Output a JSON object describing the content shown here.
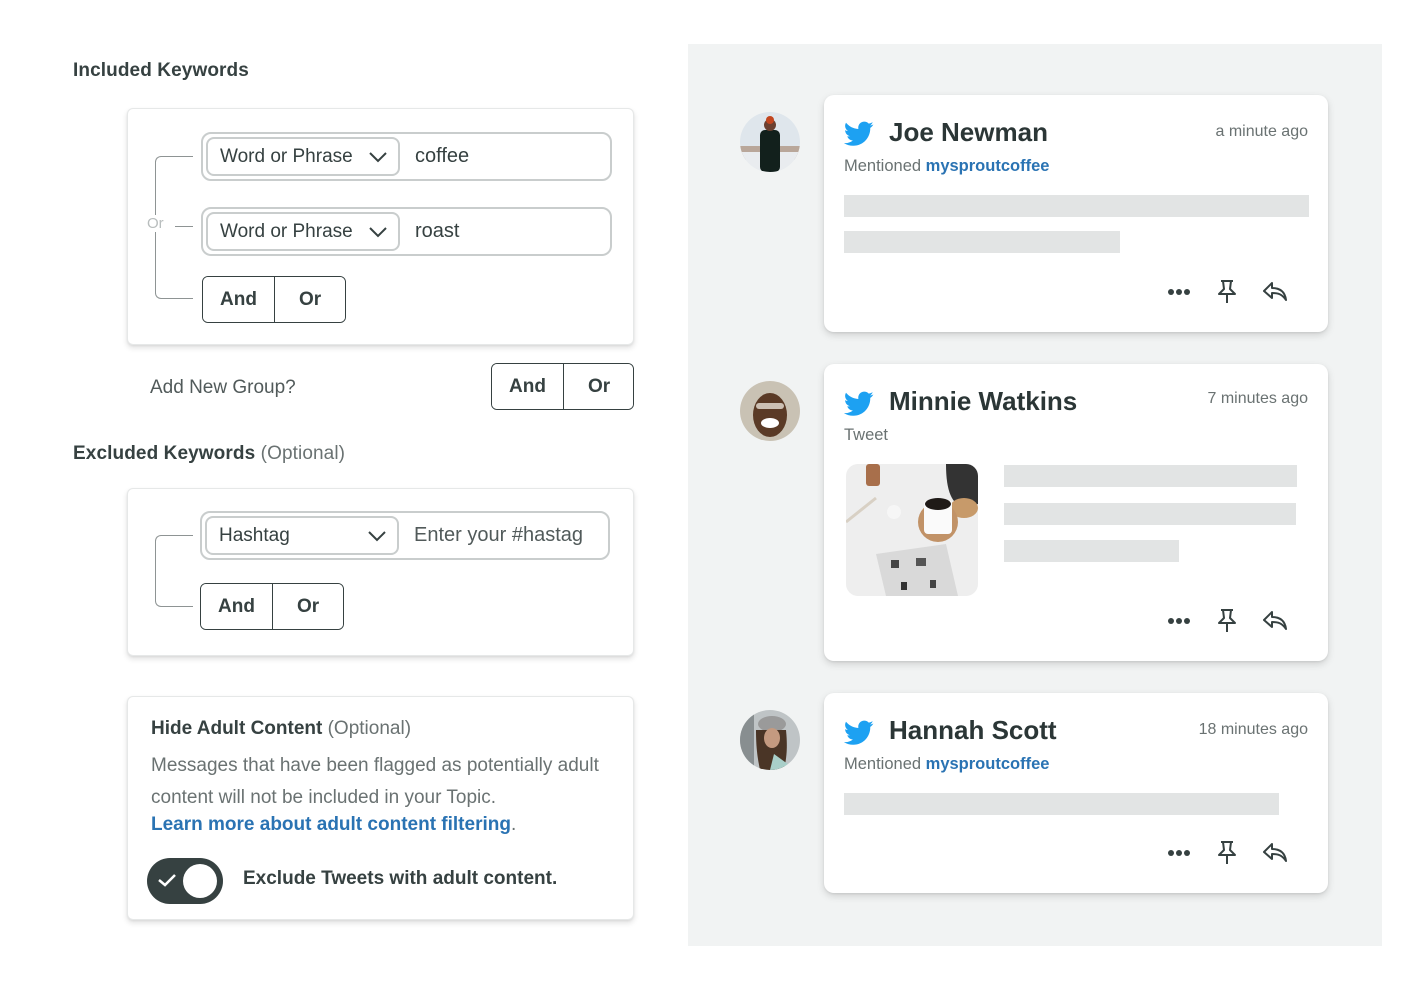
{
  "included": {
    "title": "Included Keywords",
    "connector_label": "Or",
    "rows": [
      {
        "type": "Word or Phrase",
        "value": "coffee",
        "placeholder": ""
      },
      {
        "type": "Word or Phrase",
        "value": "roast",
        "placeholder": ""
      }
    ],
    "and_label": "And",
    "or_label": "Or"
  },
  "add_group": {
    "label": "Add New Group?",
    "and_label": "And",
    "or_label": "Or"
  },
  "excluded": {
    "title": "Excluded Keywords",
    "optional": "(Optional)",
    "rows": [
      {
        "type": "Hashtag",
        "value": "",
        "placeholder": "Enter your #hastag"
      }
    ],
    "and_label": "And",
    "or_label": "Or"
  },
  "adult": {
    "title": "Hide Adult Content",
    "optional": "(Optional)",
    "description": "Messages that have been flagged as potentially adult content will not be included in your Topic.",
    "link": "Learn more about adult content filtering",
    "link_suffix": ".",
    "toggle_label": "Exclude Tweets with adult content.",
    "toggle_on": true
  },
  "colors": {
    "twitter_blue": "#1da1f2",
    "link_blue": "#2a73b3",
    "dark": "#364141",
    "panel_bg": "#f1f3f3"
  },
  "feed": [
    {
      "name": "Joe Newman",
      "time": "a minute ago",
      "sub_prefix": "Mentioned",
      "sub_handle": "mysproutcoffee",
      "icons": [
        "more-icon",
        "pin-icon",
        "reply-icon"
      ]
    },
    {
      "name": "Minnie Watkins",
      "time": "7 minutes ago",
      "sub_prefix": "Tweet",
      "sub_handle": "",
      "icons": [
        "more-icon",
        "pin-icon",
        "reply-icon"
      ]
    },
    {
      "name": "Hannah Scott",
      "time": "18 minutes ago",
      "sub_prefix": "Mentioned",
      "sub_handle": "mysproutcoffee",
      "icons": [
        "more-icon",
        "pin-icon",
        "reply-icon"
      ]
    }
  ]
}
